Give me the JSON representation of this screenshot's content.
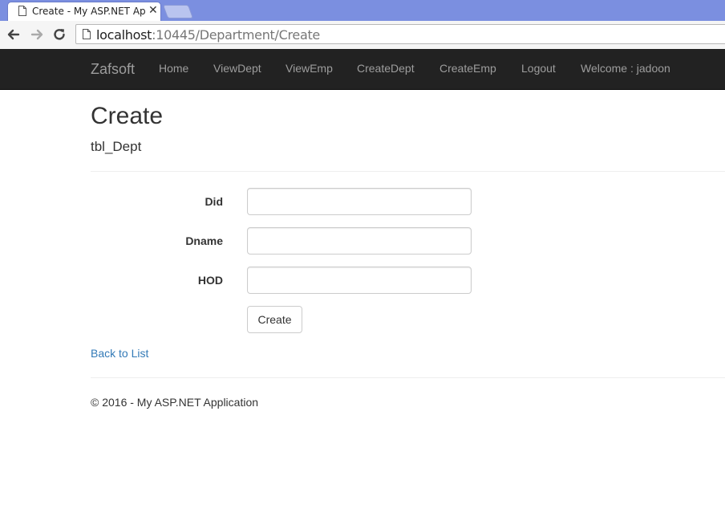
{
  "browser": {
    "tab_title": "Create - My ASP.NET App",
    "tab_close": "✕",
    "url_host": "localhost",
    "url_rest": ":10445/Department/Create"
  },
  "navbar": {
    "brand": "Zafsoft",
    "items": [
      {
        "label": "Home"
      },
      {
        "label": "ViewDept"
      },
      {
        "label": "ViewEmp"
      },
      {
        "label": "CreateDept"
      },
      {
        "label": "CreateEmp"
      },
      {
        "label": "Logout"
      },
      {
        "label": "Welcome : jadoon"
      }
    ]
  },
  "page": {
    "title": "Create",
    "subtitle": "tbl_Dept"
  },
  "form": {
    "fields": [
      {
        "label": "Did",
        "value": ""
      },
      {
        "label": "Dname",
        "value": ""
      },
      {
        "label": "HOD",
        "value": ""
      }
    ],
    "submit_label": "Create"
  },
  "back_link": "Back to List",
  "footer": "© 2016 - My ASP.NET Application",
  "colors": {
    "navbar_bg": "#222222",
    "navbar_text": "#9d9d9d",
    "link": "#337ab7",
    "tabstrip": "#7b8fe0"
  }
}
